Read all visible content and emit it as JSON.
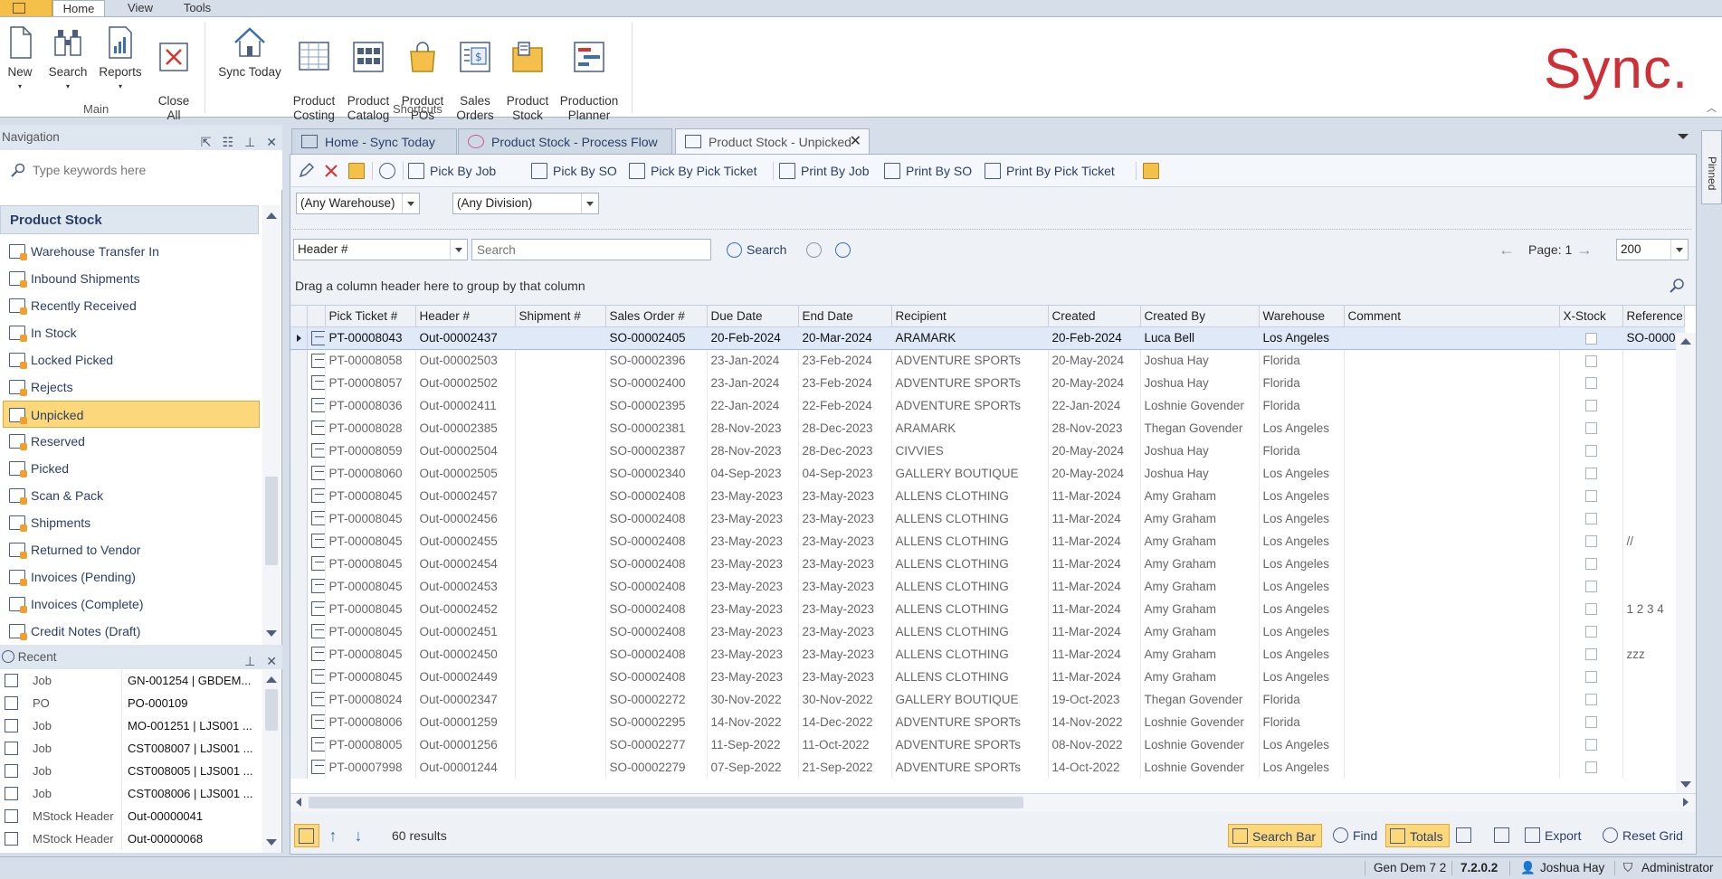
{
  "ribbon": {
    "tabs": [
      "Home",
      "View",
      "Tools"
    ],
    "main_buttons": [
      {
        "label": "New",
        "icon": "new-document-icon"
      },
      {
        "label": "Search",
        "icon": "binoculars-icon"
      },
      {
        "label": "Reports",
        "icon": "report-chart-icon"
      },
      {
        "label": "Close\nAll",
        "icon": "close-all-icon"
      }
    ],
    "shortcut_buttons": [
      {
        "label": "Sync Today",
        "icon": "home-icon"
      },
      {
        "label": "Product\nCosting",
        "icon": "costing-sheet-icon"
      },
      {
        "label": "Product\nCatalog",
        "icon": "catalog-icon"
      },
      {
        "label": "Product\nPOs",
        "icon": "shopping-bag-icon"
      },
      {
        "label": "Sales\nOrders",
        "icon": "sales-orders-icon"
      },
      {
        "label": "Product\nStock",
        "icon": "product-stock-icon"
      },
      {
        "label": "Production\nPlanner",
        "icon": "planner-icon"
      }
    ],
    "group_main": "Main",
    "group_shortcuts": "Shortcuts",
    "logo": "Sync."
  },
  "navigation": {
    "title": "Navigation",
    "search_placeholder": "Type keywords here",
    "section": "Product Stock",
    "items": [
      "Warehouse Transfer In",
      "Inbound Shipments",
      "Recently Received",
      "In Stock",
      "Locked Picked",
      "Rejects",
      "Unpicked",
      "Reserved",
      "Picked",
      "Scan & Pack",
      "Shipments",
      "Returned to Vendor",
      "Invoices (Pending)",
      "Invoices (Complete)",
      "Credit Notes (Draft)"
    ],
    "selected": "Unpicked"
  },
  "recent": {
    "title": "Recent",
    "rows": [
      {
        "type": "Job",
        "value": "GN-001254 | GBDEM..."
      },
      {
        "type": "PO",
        "value": "PO-000109"
      },
      {
        "type": "Job",
        "value": "MO-001251 | LJS001 ..."
      },
      {
        "type": "Job",
        "value": "CST008007 | LJS001 ..."
      },
      {
        "type": "Job",
        "value": "CST008005 | LJS001 ..."
      },
      {
        "type": "Job",
        "value": "CST008006 | LJS001 ..."
      },
      {
        "type": "MStock Header",
        "value": "Out-00000041"
      },
      {
        "type": "MStock Header",
        "value": "Out-00000068"
      }
    ]
  },
  "doc_tabs": [
    {
      "label": "Home - Sync Today",
      "icon": "home-tab-icon"
    },
    {
      "label": "Product Stock - Process Flow",
      "icon": "gear-icon"
    },
    {
      "label": "Product Stock - Unpicked",
      "icon": "product-stock-icon"
    }
  ],
  "pinned_label": "Pinned",
  "toolbar": {
    "pick_by_job": "Pick By Job",
    "pick_by_so": "Pick By SO",
    "pick_by_ticket": "Pick By Pick Ticket",
    "print_by_job": "Print By Job",
    "print_by_so": "Print By SO",
    "print_by_ticket": "Print By Pick Ticket"
  },
  "filters": {
    "warehouse": "(Any Warehouse)",
    "division": "(Any Division)",
    "search_field": "Header #",
    "search_placeholder": "Search",
    "search_button": "Search",
    "page_label": "Page: 1",
    "page_size": "200"
  },
  "group_hint": "Drag a column header here to group by that column",
  "grid": {
    "columns": [
      "Pick Ticket #",
      "Header #",
      "Shipment #",
      "Sales Order #",
      "Due Date",
      "End Date",
      "Recipient",
      "Created",
      "Created By",
      "Warehouse",
      "Comment",
      "X-Stock",
      "Reference"
    ],
    "rows": [
      [
        "PT-00008043",
        "Out-00002437",
        "",
        "SO-00002405",
        "20-Feb-2024",
        "20-Mar-2024",
        "ARAMARK",
        "20-Feb-2024",
        "Luca Bell",
        "Los Angeles",
        "",
        "",
        "SO-0000"
      ],
      [
        "PT-00008058",
        "Out-00002503",
        "",
        "SO-00002396",
        "23-Jan-2024",
        "23-Feb-2024",
        "ADVENTURE SPORTs",
        "20-May-2024",
        "Joshua Hay",
        "Florida",
        "",
        "",
        ""
      ],
      [
        "PT-00008057",
        "Out-00002502",
        "",
        "SO-00002400",
        "23-Jan-2024",
        "23-Feb-2024",
        "ADVENTURE SPORTs",
        "20-May-2024",
        "Joshua Hay",
        "Florida",
        "",
        "",
        ""
      ],
      [
        "PT-00008036",
        "Out-00002411",
        "",
        "SO-00002395",
        "22-Jan-2024",
        "22-Feb-2024",
        "ADVENTURE SPORTs",
        "22-Jan-2024",
        "Loshnie Govender",
        "Florida",
        "",
        "",
        ""
      ],
      [
        "PT-00008028",
        "Out-00002385",
        "",
        "SO-00002381",
        "28-Nov-2023",
        "28-Dec-2023",
        "ARAMARK",
        "28-Nov-2023",
        "Thegan Govender",
        "Los Angeles",
        "",
        "",
        ""
      ],
      [
        "PT-00008059",
        "Out-00002504",
        "",
        "SO-00002387",
        "28-Nov-2023",
        "28-Dec-2023",
        "CIVVIES",
        "20-May-2024",
        "Joshua Hay",
        "Florida",
        "",
        "",
        ""
      ],
      [
        "PT-00008060",
        "Out-00002505",
        "",
        "SO-00002340",
        "04-Sep-2023",
        "04-Sep-2023",
        "GALLERY BOUTIQUE",
        "20-May-2024",
        "Joshua Hay",
        "Los Angeles",
        "",
        "",
        ""
      ],
      [
        "PT-00008045",
        "Out-00002457",
        "",
        "SO-00002408",
        "23-May-2023",
        "23-May-2023",
        "ALLENS CLOTHING",
        "11-Mar-2024",
        "Amy Graham",
        "Los Angeles",
        "",
        "",
        ""
      ],
      [
        "PT-00008045",
        "Out-00002456",
        "",
        "SO-00002408",
        "23-May-2023",
        "23-May-2023",
        "ALLENS CLOTHING",
        "11-Mar-2024",
        "Amy Graham",
        "Los Angeles",
        "",
        "",
        ""
      ],
      [
        "PT-00008045",
        "Out-00002455",
        "",
        "SO-00002408",
        "23-May-2023",
        "23-May-2023",
        "ALLENS CLOTHING",
        "11-Mar-2024",
        "Amy Graham",
        "Los Angeles",
        "",
        "",
        "//"
      ],
      [
        "PT-00008045",
        "Out-00002454",
        "",
        "SO-00002408",
        "23-May-2023",
        "23-May-2023",
        "ALLENS CLOTHING",
        "11-Mar-2024",
        "Amy Graham",
        "Los Angeles",
        "",
        "",
        ""
      ],
      [
        "PT-00008045",
        "Out-00002453",
        "",
        "SO-00002408",
        "23-May-2023",
        "23-May-2023",
        "ALLENS CLOTHING",
        "11-Mar-2024",
        "Amy Graham",
        "Los Angeles",
        "",
        "",
        ""
      ],
      [
        "PT-00008045",
        "Out-00002452",
        "",
        "SO-00002408",
        "23-May-2023",
        "23-May-2023",
        "ALLENS CLOTHING",
        "11-Mar-2024",
        "Amy Graham",
        "Los Angeles",
        "",
        "",
        "1 2 3 4"
      ],
      [
        "PT-00008045",
        "Out-00002451",
        "",
        "SO-00002408",
        "23-May-2023",
        "23-May-2023",
        "ALLENS CLOTHING",
        "11-Mar-2024",
        "Amy Graham",
        "Los Angeles",
        "",
        "",
        ""
      ],
      [
        "PT-00008045",
        "Out-00002450",
        "",
        "SO-00002408",
        "23-May-2023",
        "23-May-2023",
        "ALLENS CLOTHING",
        "11-Mar-2024",
        "Amy Graham",
        "Los Angeles",
        "",
        "",
        "zzz"
      ],
      [
        "PT-00008045",
        "Out-00002449",
        "",
        "SO-00002408",
        "23-May-2023",
        "23-May-2023",
        "ALLENS CLOTHING",
        "11-Mar-2024",
        "Amy Graham",
        "Los Angeles",
        "",
        "",
        ""
      ],
      [
        "PT-00008024",
        "Out-00002347",
        "",
        "SO-00002272",
        "30-Nov-2022",
        "30-Nov-2022",
        "GALLERY BOUTIQUE",
        "19-Oct-2023",
        "Thegan Govender",
        "Florida",
        "",
        "",
        ""
      ],
      [
        "PT-00008006",
        "Out-00001259",
        "",
        "SO-00002295",
        "14-Nov-2022",
        "14-Dec-2022",
        "ADVENTURE SPORTs",
        "14-Nov-2022",
        "Loshnie Govender",
        "Florida",
        "",
        "",
        ""
      ],
      [
        "PT-00008005",
        "Out-00001256",
        "",
        "SO-00002277",
        "11-Sep-2022",
        "11-Oct-2022",
        "ADVENTURE SPORTs",
        "08-Nov-2022",
        "Loshnie Govender",
        "Los Angeles",
        "",
        "",
        ""
      ],
      [
        "PT-00007998",
        "Out-00001244",
        "",
        "SO-00002279",
        "07-Sep-2022",
        "21-Sep-2022",
        "ADVENTURE SPORTs",
        "14-Oct-2022",
        "Loshnie Govender",
        "Los Angeles",
        "",
        "",
        ""
      ]
    ]
  },
  "bottom_bar": {
    "results": "60 results",
    "search_bar": "Search Bar",
    "find": "Find",
    "totals": "Totals",
    "export": "Export",
    "reset_grid": "Reset Grid"
  },
  "status_bar": {
    "db": "Gen Dem 7 2",
    "version": "7.2.0.2",
    "user": "Joshua Hay",
    "role": "Administrator"
  }
}
